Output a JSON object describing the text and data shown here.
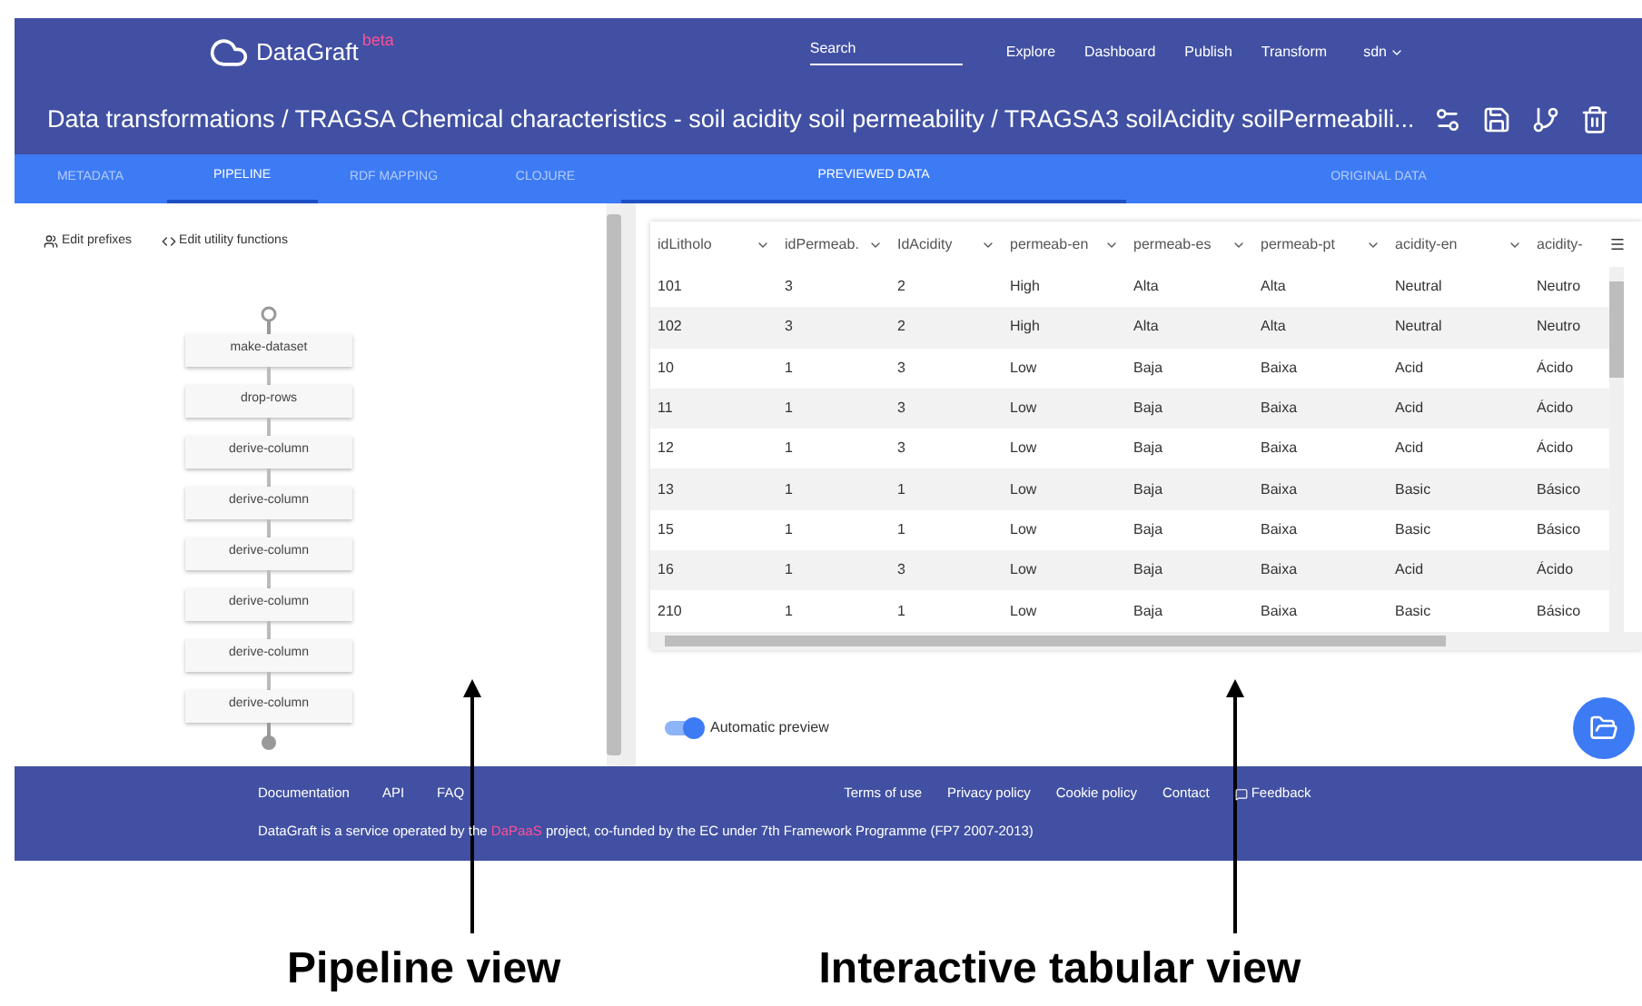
{
  "header": {
    "logo": "DataGraft",
    "logo_badge": "beta",
    "search": {
      "placeholder": "Search"
    },
    "nav": [
      "Explore",
      "Dashboard",
      "Publish",
      "Transform"
    ],
    "user": "sdn",
    "title": "Data transformations / TRAGSA Chemical characteristics - soil acidity soil permeability / TRAGSA3 soilAcidity soilPermeabili..."
  },
  "tabs_left": [
    {
      "label": "METADATA",
      "selected": false
    },
    {
      "label": "PIPELINE",
      "selected": true
    },
    {
      "label": "RDF MAPPING",
      "selected": false
    },
    {
      "label": "CLOJURE",
      "selected": false
    }
  ],
  "tabs_right": [
    {
      "label": "PREVIEWED DATA",
      "selected": true
    },
    {
      "label": "ORIGINAL DATA",
      "selected": false
    }
  ],
  "pipeline": {
    "edit_links": [
      {
        "label": "Edit prefixes",
        "kind": "prefixes"
      },
      {
        "label": "Edit utility functions",
        "kind": "code"
      }
    ],
    "steps": [
      "make-dataset",
      "drop-rows",
      "derive-column",
      "derive-column",
      "derive-column",
      "derive-column",
      "derive-column",
      "derive-column"
    ]
  },
  "table": {
    "columns": [
      "idLitholo",
      "idPermeab.",
      "IdAcidity",
      "permeab-en",
      "permeab-es",
      "permeab-pt",
      "acidity-en",
      "acidity-"
    ],
    "rows": [
      [
        "101",
        "3",
        "2",
        "High",
        "Alta",
        "Alta",
        "Neutral",
        "Neutro"
      ],
      [
        "102",
        "3",
        "2",
        "High",
        "Alta",
        "Alta",
        "Neutral",
        "Neutro"
      ],
      [
        "10",
        "1",
        "3",
        "Low",
        "Baja",
        "Baixa",
        "Acid",
        "Ácido"
      ],
      [
        "11",
        "1",
        "3",
        "Low",
        "Baja",
        "Baixa",
        "Acid",
        "Ácido"
      ],
      [
        "12",
        "1",
        "3",
        "Low",
        "Baja",
        "Baixa",
        "Acid",
        "Ácido"
      ],
      [
        "13",
        "1",
        "1",
        "Low",
        "Baja",
        "Baixa",
        "Basic",
        "Básico"
      ],
      [
        "15",
        "1",
        "1",
        "Low",
        "Baja",
        "Baixa",
        "Basic",
        "Básico"
      ],
      [
        "16",
        "1",
        "3",
        "Low",
        "Baja",
        "Baixa",
        "Acid",
        "Ácido"
      ],
      [
        "210",
        "1",
        "1",
        "Low",
        "Baja",
        "Baixa",
        "Basic",
        "Básico"
      ]
    ]
  },
  "auto_preview": {
    "label": "Automatic preview",
    "on": true
  },
  "footer": {
    "links_left": [
      "Documentation",
      "API",
      "FAQ"
    ],
    "links_right": [
      {
        "label": "Terms of use",
        "kind": "plain"
      },
      {
        "label": "Privacy policy",
        "kind": "plain"
      },
      {
        "label": "Cookie policy",
        "kind": "plain"
      },
      {
        "label": "Contact",
        "kind": "plain"
      },
      {
        "label": "Feedback",
        "kind": "feedback"
      }
    ],
    "notice_before": "DataGraft is a service operated by the",
    "notice_link": "DaPaaS",
    "notice_after": "project, co-funded by the EC under 7th Framework Programme (FP7 2007-2013)"
  },
  "annotations": [
    {
      "label": "Pipeline view"
    },
    {
      "label": "Interactive tabular view"
    }
  ]
}
